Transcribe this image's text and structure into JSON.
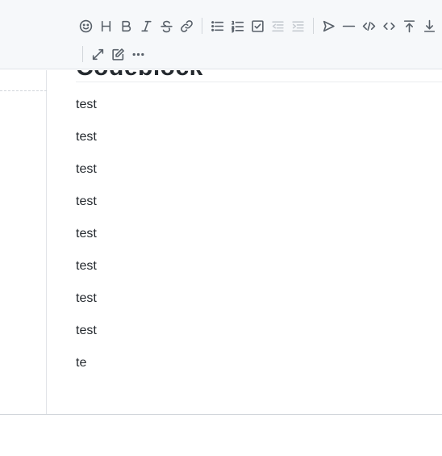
{
  "editor": {
    "heading": "Codeblock",
    "lines": [
      "test",
      "test",
      "test",
      "test",
      "test",
      "test",
      "test",
      "test",
      "te"
    ]
  },
  "toolbar": {
    "row1": [
      {
        "name": "emoji-icon",
        "glyph": ""
      },
      {
        "name": "heading-icon",
        "glyph": "H"
      },
      {
        "name": "bold-icon",
        "glyph": "B"
      },
      {
        "name": "italic-icon",
        "glyph": "I"
      },
      {
        "name": "strikethrough-icon",
        "glyph": "S"
      },
      {
        "name": "link-icon",
        "glyph": ""
      },
      {
        "name": "unordered-list-icon",
        "glyph": ""
      },
      {
        "name": "ordered-list-icon",
        "glyph": ""
      },
      {
        "name": "checklist-icon",
        "glyph": ""
      },
      {
        "name": "outdent-icon",
        "glyph": ""
      },
      {
        "name": "indent-icon",
        "glyph": ""
      },
      {
        "name": "quote-icon",
        "glyph": ""
      },
      {
        "name": "horizontal-rule-icon",
        "glyph": ""
      },
      {
        "name": "code-block-icon",
        "glyph": ""
      },
      {
        "name": "inline-code-icon",
        "glyph": ""
      },
      {
        "name": "insert-before-icon",
        "glyph": ""
      },
      {
        "name": "insert-after-icon",
        "glyph": ""
      }
    ],
    "row2": [
      {
        "name": "fullscreen-icon"
      },
      {
        "name": "edit-mode-icon"
      },
      {
        "name": "more-icon"
      }
    ]
  }
}
